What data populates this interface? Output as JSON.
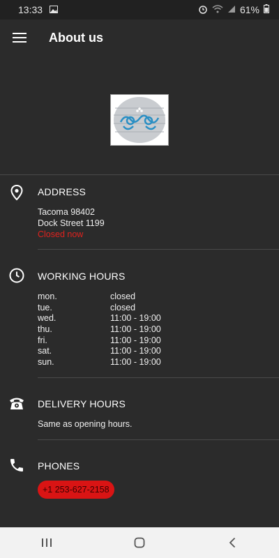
{
  "status_bar": {
    "time": "13:33",
    "battery": "61%",
    "icons": [
      "image-icon",
      "alarm-icon",
      "wifi-icon",
      "signal-icon",
      "battery-icon"
    ]
  },
  "app_bar": {
    "title": "About us",
    "menu_icon": "hamburger-menu-icon"
  },
  "logo": {
    "icon": "restaurant-logo"
  },
  "address": {
    "title": "ADDRESS",
    "icon": "location-pin-icon",
    "line1": "Tacoma 98402",
    "line2": "Dock Street 1199",
    "status": "Closed now",
    "status_color": "#e0221e"
  },
  "working_hours": {
    "title": "WORKING HOURS",
    "icon": "clock-icon",
    "rows": [
      {
        "day": "mon.",
        "hours": "closed"
      },
      {
        "day": "tue.",
        "hours": "closed"
      },
      {
        "day": "wed.",
        "hours": "11:00 - 19:00"
      },
      {
        "day": "thu.",
        "hours": "11:00 - 19:00"
      },
      {
        "day": "fri.",
        "hours": "11:00 - 19:00"
      },
      {
        "day": "sat.",
        "hours": "11:00 - 19:00"
      },
      {
        "day": "sun.",
        "hours": "11:00 - 19:00"
      }
    ]
  },
  "delivery_hours": {
    "title": "DELIVERY HOURS",
    "icon": "telephone-icon",
    "text": "Same as opening hours."
  },
  "phones": {
    "title": "PHONES",
    "icon": "phone-handset-icon",
    "number": "+1 253-627-2158",
    "accent": "#d91414"
  },
  "nav_bar": {
    "buttons": [
      "recent-apps-icon",
      "home-icon",
      "back-icon"
    ]
  }
}
